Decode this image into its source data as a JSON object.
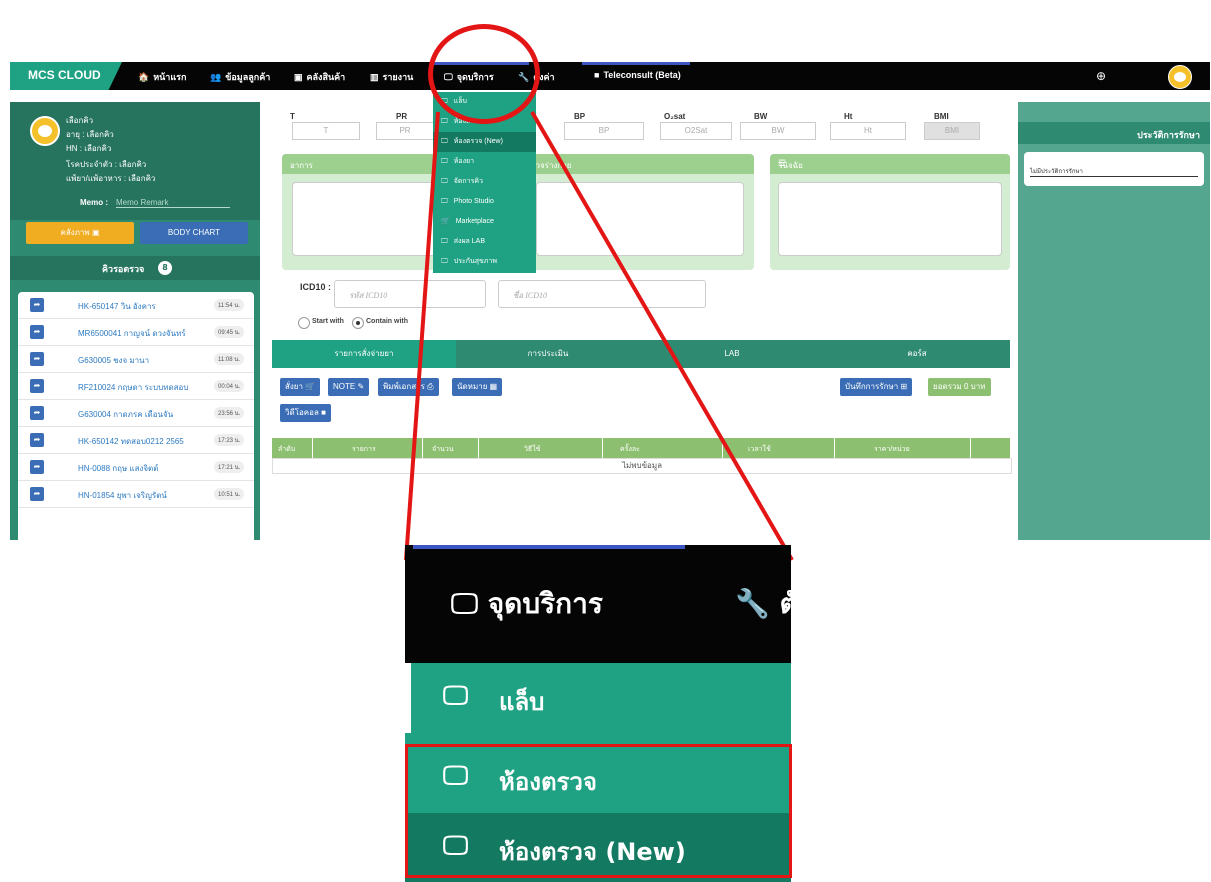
{
  "navbar": {
    "brand": "MCS CLOUD",
    "items": [
      {
        "icon": "home-icon",
        "glyph": "🏠",
        "label": "หน้าแรก"
      },
      {
        "icon": "users-icon",
        "glyph": "👥",
        "label": "ข้อมูลลูกค้า"
      },
      {
        "icon": "box-icon",
        "glyph": "▣",
        "label": "คลังสินค้า"
      },
      {
        "icon": "chart-icon",
        "glyph": "▥",
        "label": "รายงาน"
      },
      {
        "icon": "monitor-icon",
        "glyph": "🖵",
        "label": "จุดบริการ"
      },
      {
        "icon": "wrench-icon",
        "glyph": "🔧",
        "label": "ตั้งค่า"
      },
      {
        "icon": "video-icon",
        "glyph": "■",
        "label": "Teleconsult (Beta)"
      }
    ]
  },
  "patient": {
    "name": "เลือกคิว",
    "age": "อายุ : เลือกคิว",
    "hn": "HN : เลือกคิว",
    "disease": "โรคประจำตัว : เลือกคิว",
    "allergy": "แพ้ยา/แพ้อาหาร : เลือกคิว",
    "memo_label": "Memo :",
    "memo_placeholder": "Memo Remark"
  },
  "left_buttons": {
    "gallery": "คลังภาพ",
    "body_chart": "BODY CHART"
  },
  "queue": {
    "title": "คิวรอตรวจ",
    "count": "8",
    "items": [
      {
        "name": "HK-650147 วิน อังคาร",
        "time": "11:54 น."
      },
      {
        "name": "MR6500041 กาญจน์ ดวงจันทร์",
        "time": "09:45 น."
      },
      {
        "name": "G630005 ชงจ มานา",
        "time": "11:08 น."
      },
      {
        "name": "RF210024 กฤษดา ระบบทดสอบ",
        "time": "00:04 น."
      },
      {
        "name": "G630004 กาดภรค เดือนจัน",
        "time": "23:56 น."
      },
      {
        "name": "HK-650142 ทดสอบ0212 2565",
        "time": "17:23 น."
      },
      {
        "name": "HN-0088 กฤษ แสงจิตต์",
        "time": "17:21 น."
      },
      {
        "name": "HN-01854 ยุพา เจริญรัตน์",
        "time": "10:51 น."
      }
    ]
  },
  "vitals": [
    {
      "label": "T",
      "placeholder": "T"
    },
    {
      "label": "PR",
      "placeholder": "PR"
    },
    {
      "label": "BP",
      "placeholder": "BP"
    },
    {
      "label": "O₂sat",
      "placeholder": "O2Sat"
    },
    {
      "label": "BW",
      "placeholder": "BW"
    },
    {
      "label": "Ht",
      "placeholder": "Ht"
    },
    {
      "label": "BMI",
      "placeholder": "BMI"
    }
  ],
  "panels": {
    "symptoms": "อาการ",
    "exam": "ตรวจร่างกาย",
    "diagnosis": "วินิจฉัย"
  },
  "icd": {
    "label": "ICD10 :",
    "code_placeholder": "รหัส ICD10",
    "name_placeholder": "ชื่อ ICD10",
    "start_with": "Start with",
    "contain_with": "Contain with"
  },
  "tabs": [
    "รายการสั่งจ่ายยา",
    "การประเมิน",
    "LAB",
    "คอร์ส"
  ],
  "actions": {
    "order_drug": "สั่งยา",
    "note": "NOTE",
    "print_doc": "พิมพ์เอกสาร",
    "appointment": "นัดหมาย",
    "video_call": "วิดีโอคอล",
    "save_treatment": "บันทึกการรักษา",
    "total": "ยอดรวม 0 บาท"
  },
  "table": {
    "headers": [
      "ลำดับ",
      "รายการ",
      "จำนวน",
      "วิธีใช้",
      "ครั้งละ",
      "เวลาใช้",
      "ราคา/หน่วย"
    ],
    "empty": "ไม่พบข้อมูล"
  },
  "history": {
    "title": "ประวัติการรักษา",
    "empty": "ไม่มีประวัติการรักษา"
  },
  "dropdown": [
    "แล็บ",
    "ห้องตรวจ",
    "ห้องตรวจ (New)",
    "ห้องยา",
    "จัดการคิว",
    "Photo Studio",
    "Marketplace",
    "ส่งผล LAB",
    "ประกันสุขภาพ"
  ],
  "zoom": {
    "nav_label": "จุดบริการ",
    "nav_next": "ตั",
    "items": [
      "แล็บ",
      "ห้องตรวจ",
      "ห้องตรวจ (New)"
    ]
  },
  "colors": {
    "primary": "#1fa283",
    "dark": "#050505",
    "highlight": "#e31515",
    "button": "#3a6db5"
  }
}
